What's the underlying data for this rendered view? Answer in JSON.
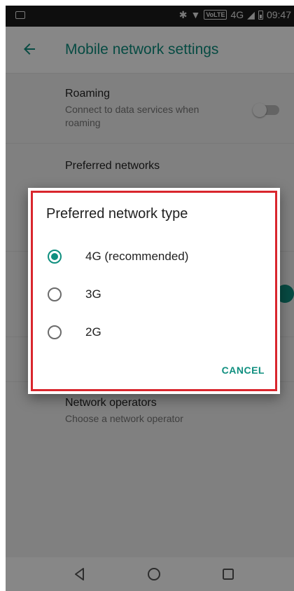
{
  "status_bar": {
    "network_label": "4G",
    "volte_label": "VoLTE",
    "time": "09:47"
  },
  "app_bar": {
    "title": "Mobile network settings"
  },
  "settings": {
    "roaming": {
      "title": "Roaming",
      "subtitle_line1": "Connect to data services when",
      "subtitle_line2": "roaming",
      "enabled": false
    },
    "preferred_networks": {
      "title": "Preferred networks"
    },
    "network_operators": {
      "title": "Network operators",
      "subtitle": "Choose a network operator"
    }
  },
  "dialog": {
    "title": "Preferred network type",
    "options": [
      {
        "label": "4G (recommended)",
        "selected": true
      },
      {
        "label": "3G",
        "selected": false
      },
      {
        "label": "2G",
        "selected": false
      }
    ],
    "cancel_label": "CANCEL",
    "highlight_color": "#d9262d"
  },
  "colors": {
    "accent": "#0f8f7f"
  },
  "icons": {
    "back": "arrow-left-icon",
    "bluetooth": "bluetooth-icon",
    "wifi": "wifi-icon",
    "signal": "cell-signal-icon",
    "battery": "battery-icon",
    "notification": "image-notification-icon",
    "nav_back": "nav-back-icon",
    "nav_home": "nav-home-icon",
    "nav_recents": "nav-recents-icon"
  }
}
